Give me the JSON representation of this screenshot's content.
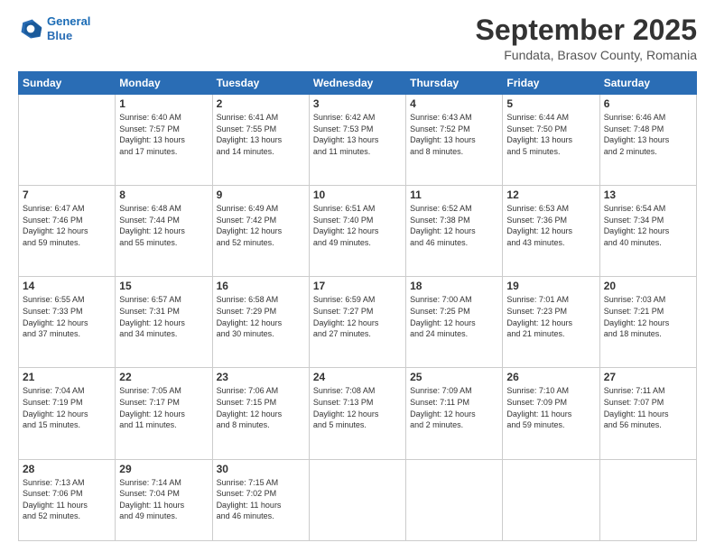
{
  "logo": {
    "line1": "General",
    "line2": "Blue"
  },
  "title": "September 2025",
  "subtitle": "Fundata, Brasov County, Romania",
  "weekdays": [
    "Sunday",
    "Monday",
    "Tuesday",
    "Wednesday",
    "Thursday",
    "Friday",
    "Saturday"
  ],
  "weeks": [
    [
      {
        "day": "",
        "text": ""
      },
      {
        "day": "1",
        "text": "Sunrise: 6:40 AM\nSunset: 7:57 PM\nDaylight: 13 hours\nand 17 minutes."
      },
      {
        "day": "2",
        "text": "Sunrise: 6:41 AM\nSunset: 7:55 PM\nDaylight: 13 hours\nand 14 minutes."
      },
      {
        "day": "3",
        "text": "Sunrise: 6:42 AM\nSunset: 7:53 PM\nDaylight: 13 hours\nand 11 minutes."
      },
      {
        "day": "4",
        "text": "Sunrise: 6:43 AM\nSunset: 7:52 PM\nDaylight: 13 hours\nand 8 minutes."
      },
      {
        "day": "5",
        "text": "Sunrise: 6:44 AM\nSunset: 7:50 PM\nDaylight: 13 hours\nand 5 minutes."
      },
      {
        "day": "6",
        "text": "Sunrise: 6:46 AM\nSunset: 7:48 PM\nDaylight: 13 hours\nand 2 minutes."
      }
    ],
    [
      {
        "day": "7",
        "text": "Sunrise: 6:47 AM\nSunset: 7:46 PM\nDaylight: 12 hours\nand 59 minutes."
      },
      {
        "day": "8",
        "text": "Sunrise: 6:48 AM\nSunset: 7:44 PM\nDaylight: 12 hours\nand 55 minutes."
      },
      {
        "day": "9",
        "text": "Sunrise: 6:49 AM\nSunset: 7:42 PM\nDaylight: 12 hours\nand 52 minutes."
      },
      {
        "day": "10",
        "text": "Sunrise: 6:51 AM\nSunset: 7:40 PM\nDaylight: 12 hours\nand 49 minutes."
      },
      {
        "day": "11",
        "text": "Sunrise: 6:52 AM\nSunset: 7:38 PM\nDaylight: 12 hours\nand 46 minutes."
      },
      {
        "day": "12",
        "text": "Sunrise: 6:53 AM\nSunset: 7:36 PM\nDaylight: 12 hours\nand 43 minutes."
      },
      {
        "day": "13",
        "text": "Sunrise: 6:54 AM\nSunset: 7:34 PM\nDaylight: 12 hours\nand 40 minutes."
      }
    ],
    [
      {
        "day": "14",
        "text": "Sunrise: 6:55 AM\nSunset: 7:33 PM\nDaylight: 12 hours\nand 37 minutes."
      },
      {
        "day": "15",
        "text": "Sunrise: 6:57 AM\nSunset: 7:31 PM\nDaylight: 12 hours\nand 34 minutes."
      },
      {
        "day": "16",
        "text": "Sunrise: 6:58 AM\nSunset: 7:29 PM\nDaylight: 12 hours\nand 30 minutes."
      },
      {
        "day": "17",
        "text": "Sunrise: 6:59 AM\nSunset: 7:27 PM\nDaylight: 12 hours\nand 27 minutes."
      },
      {
        "day": "18",
        "text": "Sunrise: 7:00 AM\nSunset: 7:25 PM\nDaylight: 12 hours\nand 24 minutes."
      },
      {
        "day": "19",
        "text": "Sunrise: 7:01 AM\nSunset: 7:23 PM\nDaylight: 12 hours\nand 21 minutes."
      },
      {
        "day": "20",
        "text": "Sunrise: 7:03 AM\nSunset: 7:21 PM\nDaylight: 12 hours\nand 18 minutes."
      }
    ],
    [
      {
        "day": "21",
        "text": "Sunrise: 7:04 AM\nSunset: 7:19 PM\nDaylight: 12 hours\nand 15 minutes."
      },
      {
        "day": "22",
        "text": "Sunrise: 7:05 AM\nSunset: 7:17 PM\nDaylight: 12 hours\nand 11 minutes."
      },
      {
        "day": "23",
        "text": "Sunrise: 7:06 AM\nSunset: 7:15 PM\nDaylight: 12 hours\nand 8 minutes."
      },
      {
        "day": "24",
        "text": "Sunrise: 7:08 AM\nSunset: 7:13 PM\nDaylight: 12 hours\nand 5 minutes."
      },
      {
        "day": "25",
        "text": "Sunrise: 7:09 AM\nSunset: 7:11 PM\nDaylight: 12 hours\nand 2 minutes."
      },
      {
        "day": "26",
        "text": "Sunrise: 7:10 AM\nSunset: 7:09 PM\nDaylight: 11 hours\nand 59 minutes."
      },
      {
        "day": "27",
        "text": "Sunrise: 7:11 AM\nSunset: 7:07 PM\nDaylight: 11 hours\nand 56 minutes."
      }
    ],
    [
      {
        "day": "28",
        "text": "Sunrise: 7:13 AM\nSunset: 7:06 PM\nDaylight: 11 hours\nand 52 minutes."
      },
      {
        "day": "29",
        "text": "Sunrise: 7:14 AM\nSunset: 7:04 PM\nDaylight: 11 hours\nand 49 minutes."
      },
      {
        "day": "30",
        "text": "Sunrise: 7:15 AM\nSunset: 7:02 PM\nDaylight: 11 hours\nand 46 minutes."
      },
      {
        "day": "",
        "text": ""
      },
      {
        "day": "",
        "text": ""
      },
      {
        "day": "",
        "text": ""
      },
      {
        "day": "",
        "text": ""
      }
    ]
  ]
}
